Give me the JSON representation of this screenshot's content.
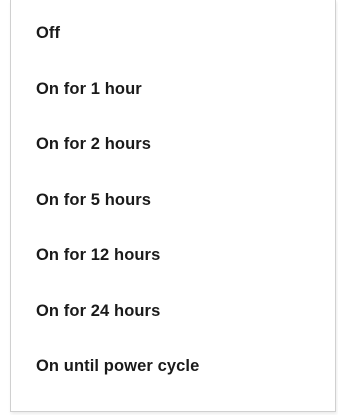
{
  "menu": {
    "items": [
      {
        "label": "Off"
      },
      {
        "label": "On for 1 hour"
      },
      {
        "label": "On for 2 hours"
      },
      {
        "label": "On for 5 hours"
      },
      {
        "label": "On for 12 hours"
      },
      {
        "label": "On for 24 hours"
      },
      {
        "label": "On until power cycle"
      }
    ]
  }
}
